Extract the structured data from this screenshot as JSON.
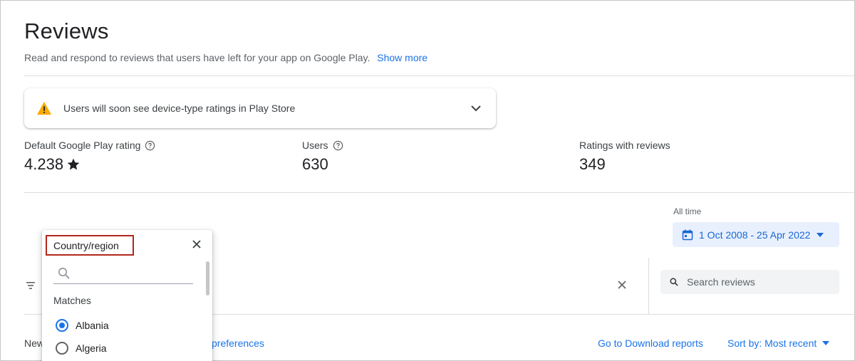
{
  "page": {
    "title": "Reviews",
    "description": "Read and respond to reviews that users have left for your app on Google Play.",
    "show_more": "Show more"
  },
  "banner": {
    "text": "Users will soon see device-type ratings in Play Store",
    "icon": "warning-icon"
  },
  "stats": {
    "rating": {
      "label": "Default Google Play rating",
      "value": "4.238"
    },
    "users": {
      "label": "Users",
      "value": "630"
    },
    "ratings_with_reviews": {
      "label": "Ratings with reviews",
      "value": "349"
    }
  },
  "date_filter": {
    "caption": "All time",
    "range": "1 Oct 2008 - 25 Apr 2022"
  },
  "search": {
    "placeholder": "Search reviews"
  },
  "footer": {
    "new_prefix": "New",
    "preferences_link": "preferences",
    "download_link": "Go to Download reports",
    "sort_label": "Sort by: Most recent"
  },
  "country_popup": {
    "title": "Country/region",
    "matches_label": "Matches",
    "options": [
      {
        "label": "Albania",
        "selected": true
      },
      {
        "label": "Algeria",
        "selected": false
      }
    ]
  },
  "colors": {
    "accent": "#1a73e8",
    "warning": "#f9ab00",
    "highlight_border": "#b3261e",
    "date_chip_bg": "#e8f0fe"
  }
}
